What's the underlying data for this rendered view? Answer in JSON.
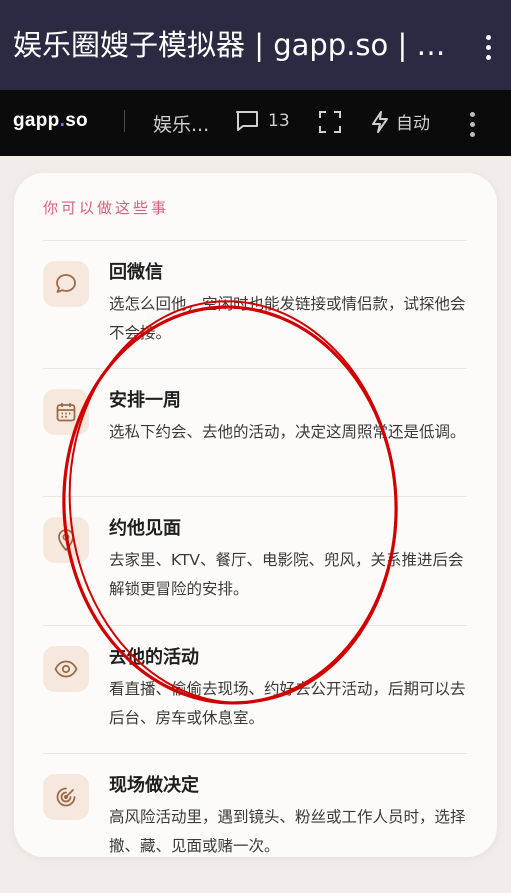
{
  "window": {
    "title": "娱乐圈嫂子模拟器 | gapp.so | g..."
  },
  "toolbar": {
    "brand_prefix": "gapp",
    "brand_dot": ".",
    "brand_suffix": "so",
    "crumb": "娱乐...",
    "comment_count": "13",
    "auto_label": "自动"
  },
  "card": {
    "heading": "你可以做这些事",
    "items": [
      {
        "icon": "chat-bubble-icon",
        "title": "回微信",
        "desc": "选怎么回他，空闲时也能发链接或情侣款，试探他会不会接。"
      },
      {
        "icon": "calendar-icon",
        "title": "安排一周",
        "desc": "选私下约会、去他的活动，决定这周照常还是低调。"
      },
      {
        "icon": "location-pin-icon",
        "title": "约他见面",
        "desc": "去家里、KTV、餐厅、电影院、兜风，关系推进后会解锁更冒险的安排。"
      },
      {
        "icon": "eye-icon",
        "title": "去他的活动",
        "desc": "看直播、偷偷去现场、约好去公开活动，后期可以去后台、房车或休息室。"
      },
      {
        "icon": "radar-icon",
        "title": "现场做决定",
        "desc": "高风险活动里，遇到镜头、粉丝或工作人员时，选择撤、藏、见面或赌一次。"
      }
    ]
  },
  "colors": {
    "accent_pink": "#d95f7c",
    "icon_brown": "#9a6a4a",
    "icon_bg": "#f6e8dc",
    "annotation_red": "#d10000"
  }
}
